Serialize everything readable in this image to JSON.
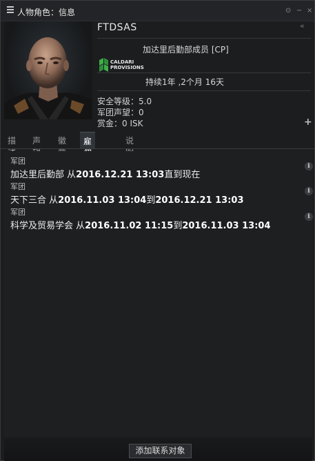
{
  "window": {
    "title": "人物角色：信息",
    "controls": [
      "⊙",
      "−",
      "×"
    ],
    "collapse_label": "«"
  },
  "character": {
    "name": "FTDSAS",
    "corporation": "加达里后勤部成员 [CP]",
    "corp_logo_line1": "CALDARI",
    "corp_logo_line2": "PROVISIONS",
    "duration": "持续1年 ,2个月 16天",
    "security": "安全等级：5.0",
    "standing": "军团声望：0",
    "bounty": "赏金：0 ISK"
  },
  "add_icon": "+",
  "tabs": [
    "描述",
    "声望",
    "徽章",
    "雇佣纪录",
    "说明"
  ],
  "active_tab": "雇佣纪录",
  "history": [
    {
      "type": "军团",
      "corp": "加达里后勤部",
      "from_word": "从",
      "start": "2016.12.21 13:03",
      "to_word": "直到现在",
      "end": ""
    },
    {
      "type": "军团",
      "corp": "天下三合",
      "from_word": "从",
      "start": "2016.11.03 13:04",
      "to_word": "到",
      "end": "2016.12.21 13:03"
    },
    {
      "type": "军团",
      "corp": "科学及贸易学会",
      "from_word": "从",
      "start": "2016.11.02 11:15",
      "to_word": "到",
      "end": "2016.11.03 13:04"
    }
  ],
  "info_icon_glyph": "i",
  "footer": {
    "button_label": "添加联系对象"
  },
  "colors": {
    "window_bg": "#1c1d1f",
    "active_tab_bg": "#2f3438",
    "logo_green": "#3fae49"
  }
}
